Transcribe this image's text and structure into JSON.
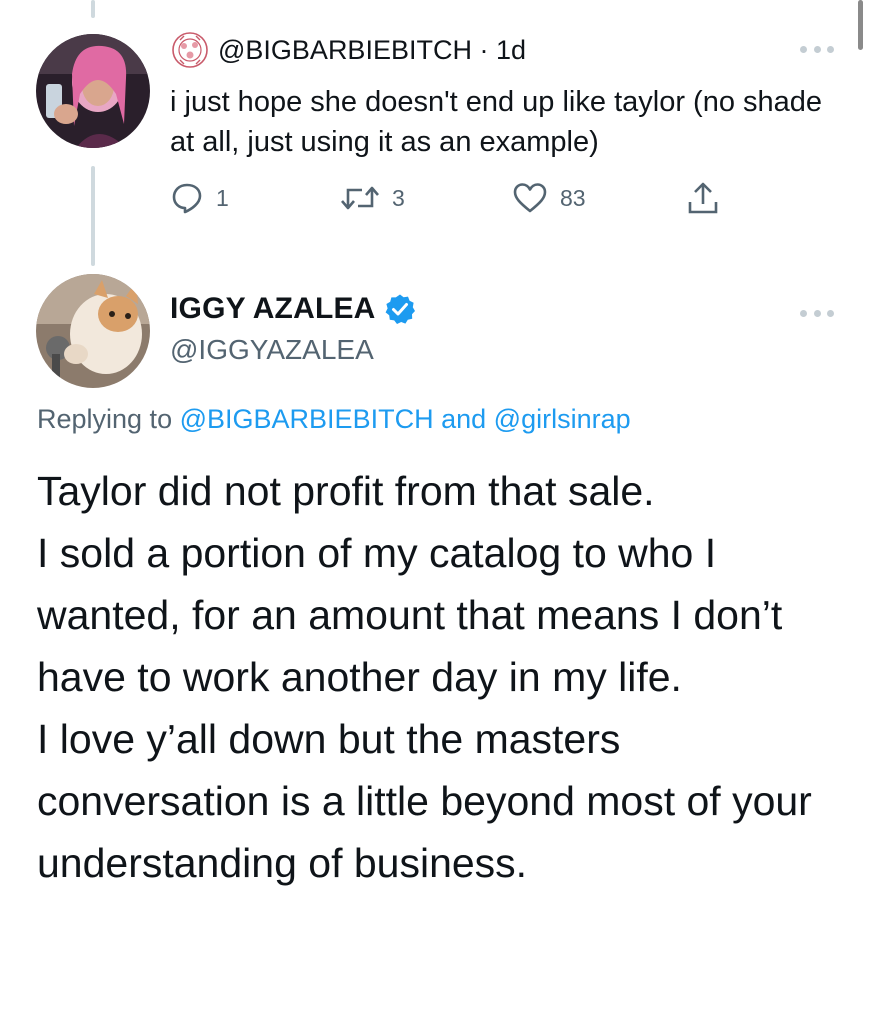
{
  "reply_tweet": {
    "handle": "@BIGBARBIEBITCH",
    "time": "· 1d",
    "text": "i just hope she doesn't end up like taylor (no shade at all, just using it as an example)",
    "badge_icon": "rose-crest-icon",
    "actions": {
      "reply_count": "1",
      "retweet_count": "3",
      "like_count": "83"
    }
  },
  "main_tweet": {
    "display_name": "IGGY AZALEA",
    "verified": true,
    "handle": "@IGGYAZALEA",
    "replying_prefix": "Replying to",
    "replying_to_1": "@BIGBARBIEBITCH",
    "replying_and": "and",
    "replying_to_2": "@girlsinrap",
    "text_lines": [
      "Taylor did not profit from that sale.",
      "I sold a portion of my catalog to who I wanted, for an amount that means I don’t have to work another day in my life.",
      "I love y’all down but the masters conversation is a little beyond most of your understanding of business."
    ]
  },
  "colors": {
    "text": "#0f1419",
    "secondary": "#536471",
    "link": "#1d9bf0",
    "thread_line": "#cfd9de"
  }
}
